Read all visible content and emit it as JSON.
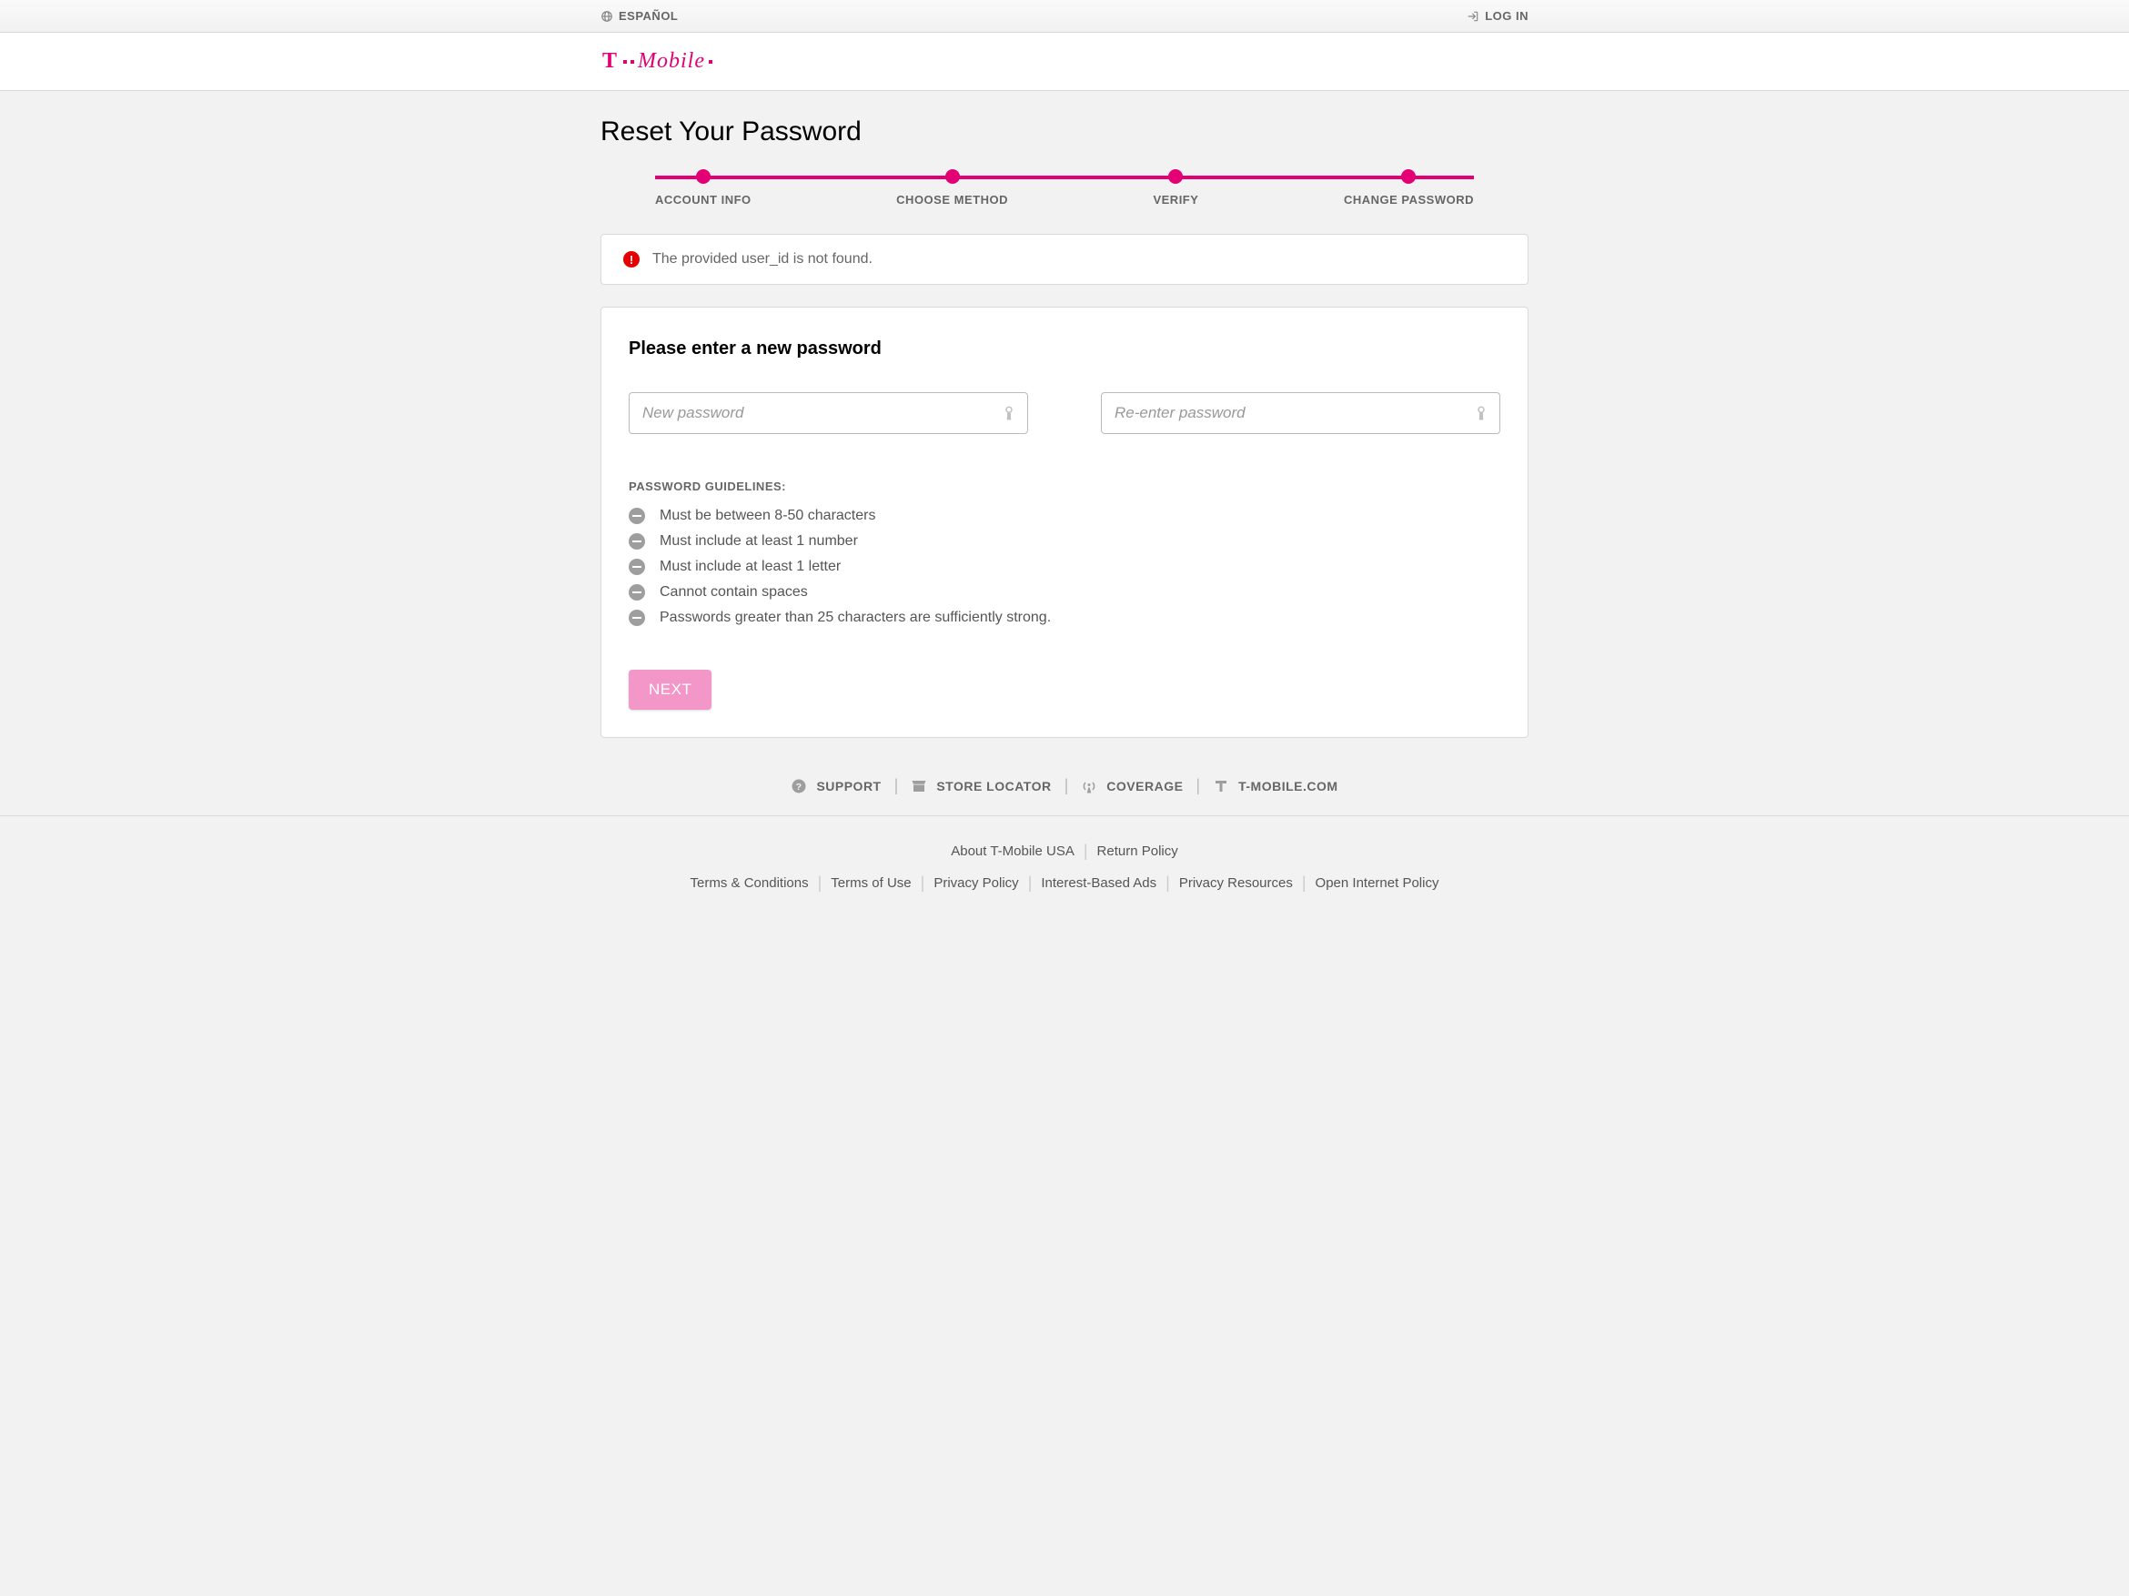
{
  "topbar": {
    "language": "ESPAÑOL",
    "login": "LOG IN"
  },
  "brand": "T Mobile",
  "page_title": "Reset Your Password",
  "steps": [
    {
      "label": "ACCOUNT INFO"
    },
    {
      "label": "CHOOSE METHOD"
    },
    {
      "label": "VERIFY"
    },
    {
      "label": "CHANGE PASSWORD"
    }
  ],
  "error_message": "The provided user_id is not found.",
  "form": {
    "heading": "Please enter a new password",
    "new_password_placeholder": "New password",
    "reenter_password_placeholder": "Re-enter password",
    "guidelines_title": "PASSWORD GUIDELINES:",
    "guidelines": [
      "Must be between 8-50 characters",
      "Must include at least 1 number",
      "Must include at least 1 letter",
      "Cannot contain spaces",
      "Passwords greater than 25 characters are sufficiently strong."
    ],
    "next_label": "NEXT"
  },
  "footer_primary": [
    "SUPPORT",
    "STORE LOCATOR",
    "COVERAGE",
    "T-MOBILE.COM"
  ],
  "footer_secondary_row1": [
    "About T-Mobile USA",
    "Return Policy"
  ],
  "footer_secondary_row2": [
    "Terms & Conditions",
    "Terms of Use",
    "Privacy Policy",
    "Interest-Based Ads",
    "Privacy Resources",
    "Open Internet Policy"
  ]
}
